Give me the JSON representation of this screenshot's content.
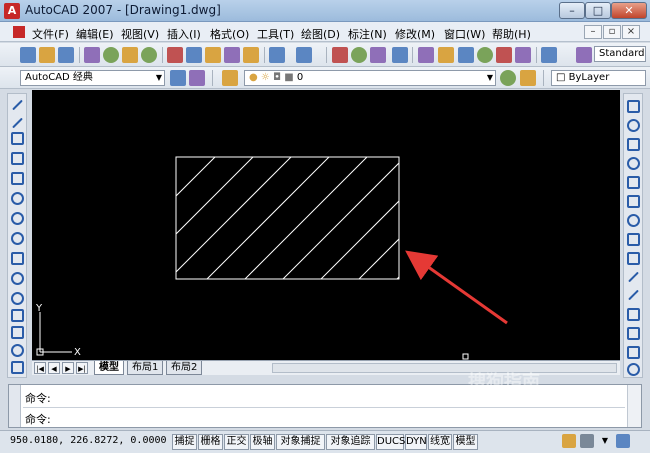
{
  "window": {
    "title": "AutoCAD 2007 - [Drawing1.dwg]",
    "min_glyph": "–",
    "max_glyph": "□",
    "close_glyph": "✕"
  },
  "menu": {
    "items": [
      "文件(F)",
      "编辑(E)",
      "视图(V)",
      "插入(I)",
      "格式(O)",
      "工具(T)",
      "绘图(D)",
      "标注(N)",
      "修改(M)",
      "窗口(W)",
      "帮助(H)"
    ],
    "doc_controls": [
      "–",
      "▫",
      "×"
    ]
  },
  "toolbar1": {
    "text_style": "Standard"
  },
  "toolbar2": {
    "workspace": "AutoCAD 经典",
    "layer": "0",
    "color": "ByLayer"
  },
  "canvas": {
    "background": "#000000",
    "ucs_x": "X",
    "ucs_y": "Y",
    "arrow_color": "#e53935"
  },
  "tabs": {
    "items": [
      "模型",
      "布局1",
      "布局2"
    ],
    "nav": [
      "|◀",
      "◀",
      "▶",
      "▶|"
    ]
  },
  "command": {
    "line1": "命令:",
    "line2": "命令:"
  },
  "status": {
    "coords": "950.0180,  226.8272, 0.0000",
    "toggles": [
      "捕捉",
      "栅格",
      "正交",
      "极轴",
      "对象捕捉",
      "对象追踪",
      "DUCS",
      "DYN",
      "线宽",
      "模型"
    ]
  },
  "watermark": "搜狗指南"
}
